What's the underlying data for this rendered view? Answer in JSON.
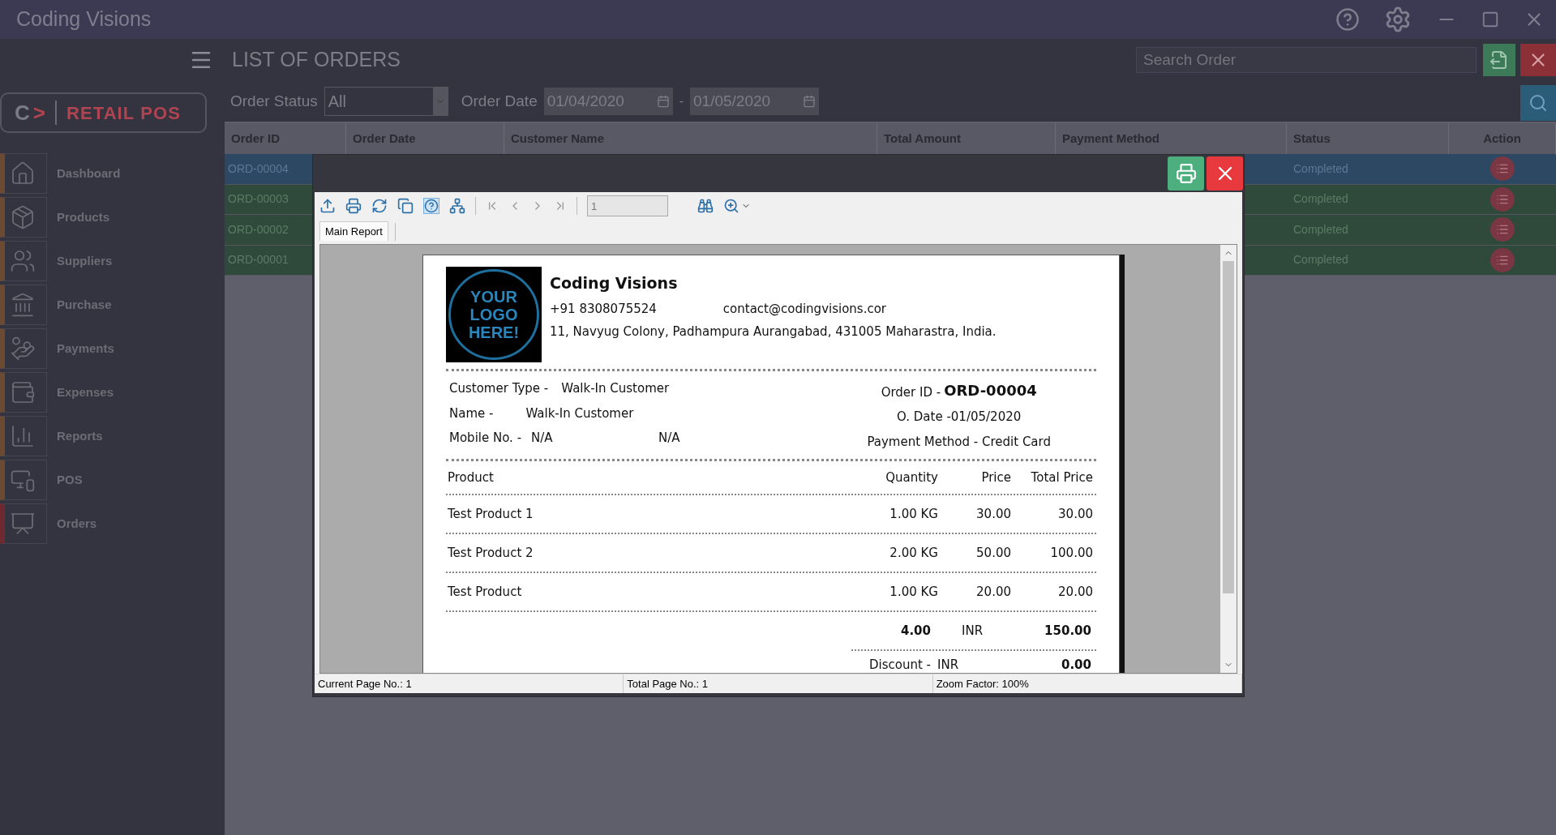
{
  "window": {
    "title": "Coding Visions"
  },
  "sidebar": {
    "logo": {
      "mark": "C",
      "arrow": ">",
      "name": "RETAIL POS"
    },
    "items": [
      {
        "label": "Dashboard",
        "selected": false
      },
      {
        "label": "Products",
        "selected": false
      },
      {
        "label": "Suppliers",
        "selected": false
      },
      {
        "label": "Purchase",
        "selected": false
      },
      {
        "label": "Payments",
        "selected": false
      },
      {
        "label": "Expenses",
        "selected": false
      },
      {
        "label": "Reports",
        "selected": false
      },
      {
        "label": "POS",
        "selected": false
      },
      {
        "label": "Orders",
        "selected": true
      }
    ]
  },
  "header": {
    "title": "LIST OF ORDERS",
    "search": {
      "placeholder": "Search Order"
    }
  },
  "filters": {
    "status_label": "Order Status",
    "status_value": "All",
    "date_label": "Order Date",
    "date_from": "01/04/2020",
    "separator": "-",
    "date_to": "01/05/2020"
  },
  "table": {
    "columns": [
      "Order ID",
      "Order Date",
      "Customer Name",
      "Total Amount",
      "Payment Method",
      "Status",
      "Action"
    ],
    "rows": [
      {
        "order_id": "ORD-00004",
        "status": "Completed",
        "selected": true
      },
      {
        "order_id": "ORD-00003",
        "status": "Completed",
        "selected": false
      },
      {
        "order_id": "ORD-00002",
        "status": "Completed",
        "selected": false
      },
      {
        "order_id": "ORD-00001",
        "status": "Completed",
        "selected": false
      }
    ]
  },
  "report_dialog": {
    "page_field": "1",
    "tabs": [
      {
        "label": "Main Report",
        "selected": true
      }
    ],
    "report": {
      "logo_text": "YOUR LOGO HERE!",
      "company": "Coding Visions",
      "phone": "+91 8308075524",
      "email": "contact@codingvisions.cor",
      "address": "11, Navyug Colony, Padhampura Aurangabad, 431005 Maharastra, India.",
      "customer_type_label": "Customer Type -",
      "customer_type": "Walk-In Customer",
      "name_label": "Name -",
      "name": "Walk-In Customer",
      "mobile_label": "Mobile No. -",
      "mobile": "N/A",
      "mobile_2": "N/A",
      "order_id_label": "Order ID -",
      "order_id": "ORD-00004",
      "order_date": "O. Date -01/05/2020",
      "payment": "Payment Method - Credit Card",
      "columns": [
        "Product",
        "Quantity",
        "Price",
        "Total Price"
      ],
      "items": [
        {
          "product": "Test Product 1",
          "quantity": "1.00 KG",
          "price": "30.00",
          "total": "30.00"
        },
        {
          "product": "Test Product 2",
          "quantity": "2.00 KG",
          "price": "50.00",
          "total": "100.00"
        },
        {
          "product": "Test Product",
          "quantity": "1.00 KG",
          "price": "20.00",
          "total": "20.00"
        }
      ],
      "total_quantity": "4.00",
      "total_currency": "INR",
      "total_amount": "150.00",
      "discount_label": "Discount -",
      "discount_currency": "INR",
      "discount": "0.00"
    },
    "status_bar": [
      "Current Page No.: 1",
      "Total Page No.: 1",
      "Zoom Factor: 100%"
    ]
  }
}
